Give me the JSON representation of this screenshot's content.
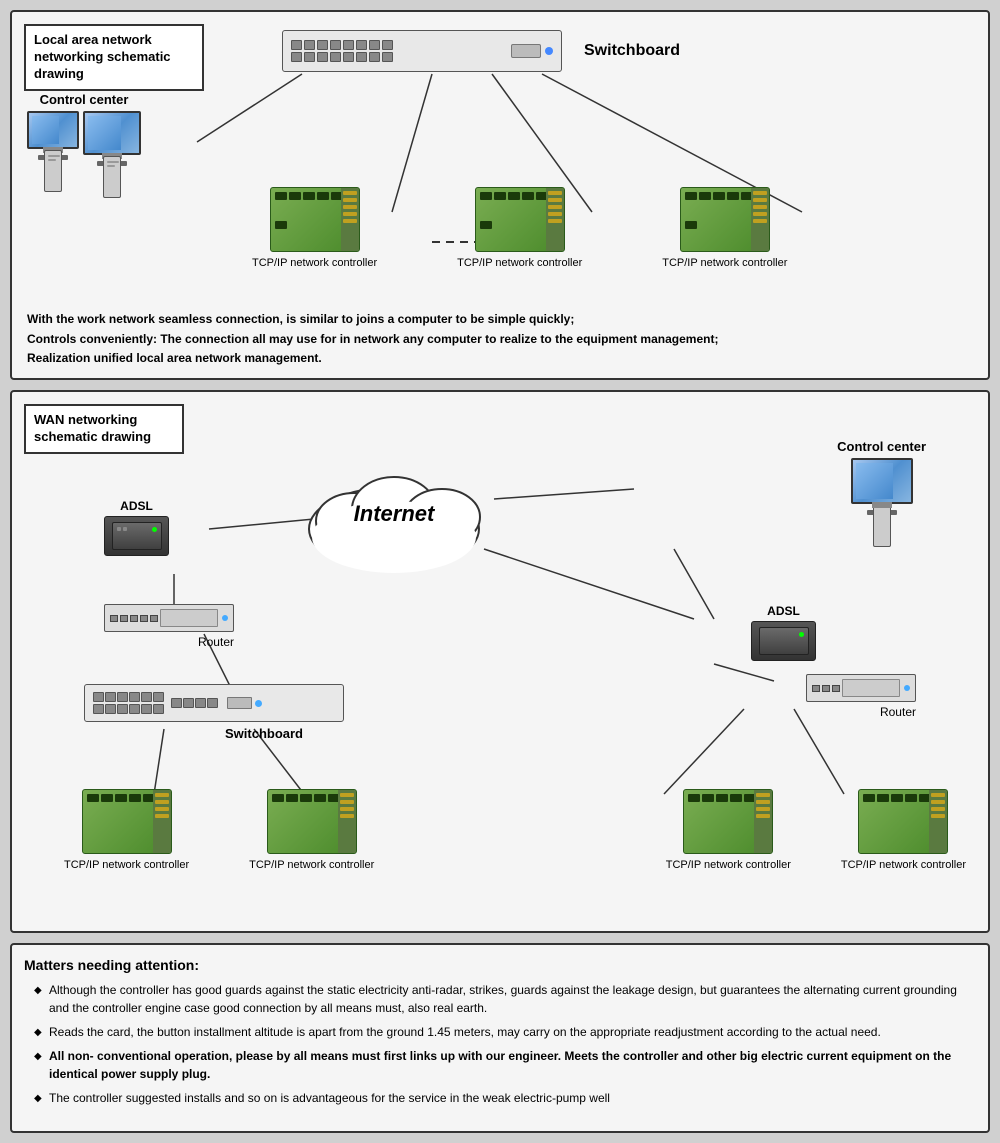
{
  "panel1": {
    "label": "Local area network networking schematic drawing",
    "switchboard_label": "Switchboard",
    "control_center_label": "Control center",
    "controllers": [
      "TCP/IP network controller",
      "TCP/IP network controller",
      "TCP/IP network controller"
    ],
    "description": [
      "With the work network seamless connection, is similar to joins a computer to be simple quickly;",
      "Controls conveniently: The connection all may use for in network any computer to realize to the equipment management;",
      "Realization unified local area network management."
    ]
  },
  "panel2": {
    "label": "WAN networking schematic drawing",
    "internet_label": "Internet",
    "control_center_label": "Control center",
    "adsl_label": "ADSL",
    "adsl_label_right": "ADSL",
    "router_label": "Router",
    "router_label_right": "Router",
    "switchboard_label": "Switchboard",
    "controllers": [
      "TCP/IP network controller",
      "TCP/IP network controller",
      "TCP/IP network controller",
      "TCP/IP network controller"
    ]
  },
  "panel3": {
    "title": "Matters needing attention:",
    "items": [
      "Although the controller has good guards against the static electricity anti-radar, strikes, guards against the leakage design, but guarantees the alternating current grounding and the controller engine case good connection by all means must, also real earth.",
      "Reads the card, the button installment altitude is apart from the ground 1.45 meters, may carry on the appropriate readjustment according to the actual need.",
      "All non- conventional operation, please by all means must first links up with our engineer. Meets the controller and other big electric current equipment on the identical power supply plug.",
      "The controller suggested installs and so on is advantageous for the service in the weak electric-pump well"
    ]
  }
}
